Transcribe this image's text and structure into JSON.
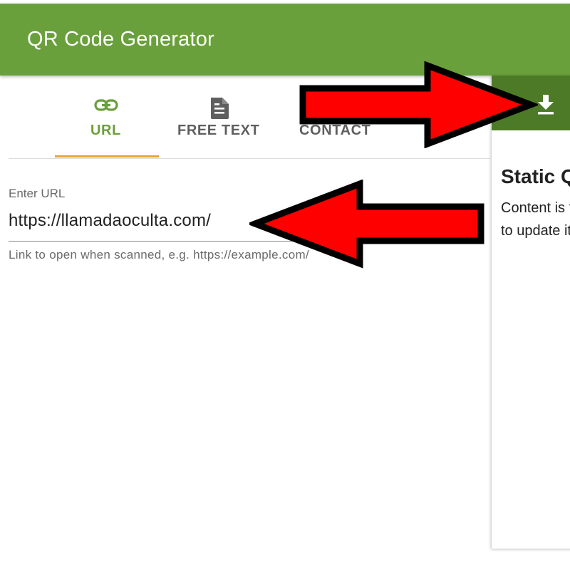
{
  "app": {
    "title": "QR Code Generator"
  },
  "tabs": [
    {
      "label": "URL",
      "icon": "link-icon",
      "active": true
    },
    {
      "label": "FREE TEXT",
      "icon": "document-icon",
      "active": false
    },
    {
      "label": "CONTACT",
      "icon": "contact-icon",
      "active": false
    }
  ],
  "url_field": {
    "label": "Enter URL",
    "value": "https://llamadaoculta.com/",
    "helper": "Link to open when scanned, e.g. https://example.com/"
  },
  "side_panel": {
    "download_icon": "download-icon",
    "title": "Static QR Code",
    "desc_line1": "Content is fixed",
    "desc_line2": "to update it"
  },
  "colors": {
    "app_bar": "#69a03b",
    "side_header": "#4d7a26",
    "active_tab_text": "#6b9e3d",
    "tab_indicator": "#e8a43a",
    "annotation_arrow": "#ff0000"
  }
}
